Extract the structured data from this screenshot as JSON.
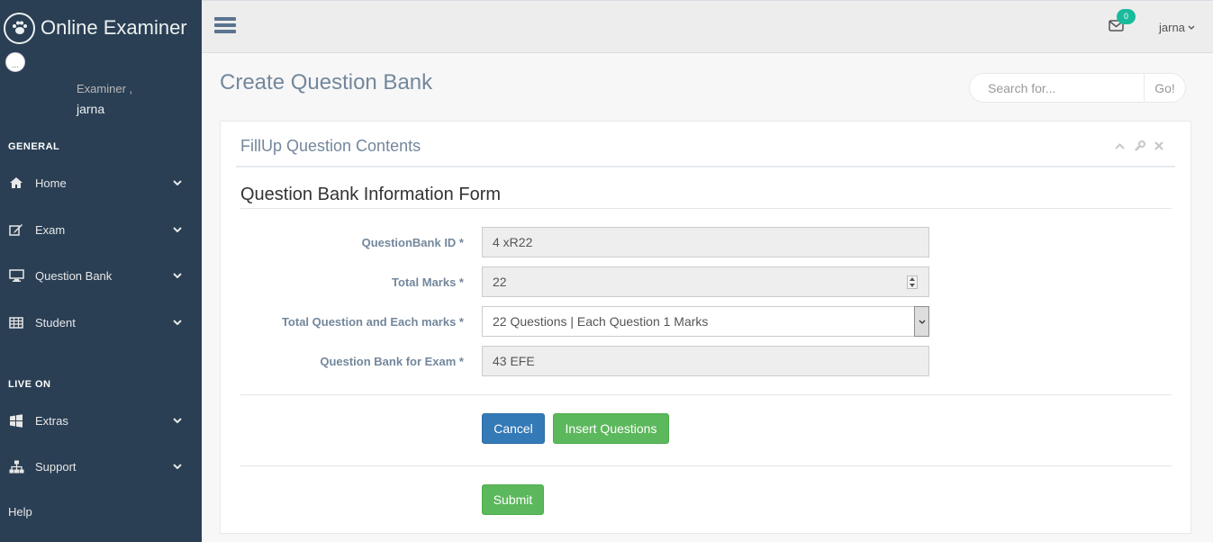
{
  "app": {
    "title": "Online Examiner",
    "profile_pic_text": "...",
    "role": "Examiner ,",
    "user": "jarna"
  },
  "sidebar": {
    "sections": [
      {
        "title": "GENERAL",
        "items": [
          {
            "label": "Home",
            "icon": "home-icon"
          },
          {
            "label": "Exam",
            "icon": "edit-icon"
          },
          {
            "label": "Question Bank",
            "icon": "desktop-icon"
          },
          {
            "label": "Student",
            "icon": "table-icon"
          }
        ]
      },
      {
        "title": "LIVE ON",
        "items": [
          {
            "label": "Extras",
            "icon": "windows-icon"
          },
          {
            "label": "Support",
            "icon": "sitemap-icon"
          }
        ]
      }
    ],
    "help": "Help"
  },
  "topnav": {
    "mail_badge": "0",
    "username": "jarna"
  },
  "page": {
    "title": "Create Question Bank",
    "search_placeholder": "Search for...",
    "search_button": "Go!"
  },
  "panel": {
    "title": "FillUp Question Contents",
    "form_title": "Question Bank Information Form",
    "fields": [
      {
        "label": "QuestionBank ID *",
        "value": "4 xR22"
      },
      {
        "label": "Total Marks *",
        "value": "22"
      },
      {
        "label": "Total Question and Each marks *",
        "value": "22 Questions | Each Question 1 Marks"
      },
      {
        "label": "Question Bank for Exam *",
        "value": "43 EFE"
      }
    ],
    "cancel": "Cancel",
    "insert": "Insert Questions",
    "submit": "Submit"
  }
}
